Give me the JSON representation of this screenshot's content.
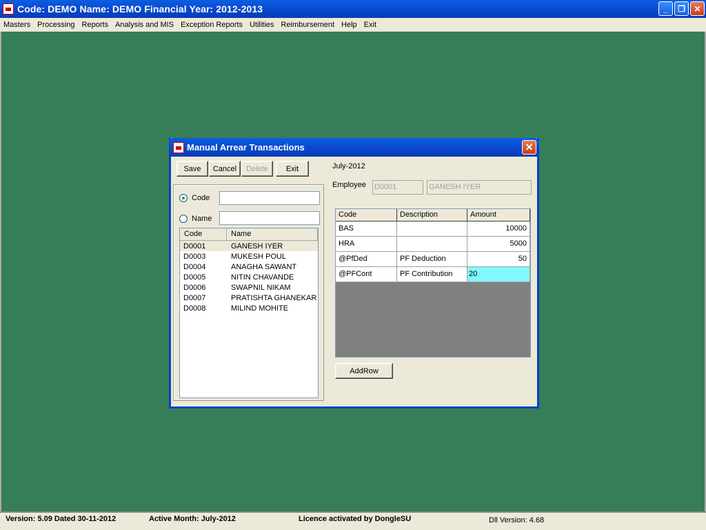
{
  "window": {
    "title": "Code: DEMO Name: DEMO Financial Year: 2012-2013",
    "btn_minimize": "_",
    "btn_restore": "❐",
    "btn_close": "✕"
  },
  "menu": [
    "Masters",
    "Processing",
    "Reports",
    "Analysis and MIS",
    "Exception Reports",
    "Utilities",
    "Reimbursement",
    "Help",
    "Exit"
  ],
  "dialog": {
    "title": "Manual Arrear Transactions",
    "close": "✕",
    "buttons": {
      "save": "Save",
      "cancel": "Cancel",
      "delete": "Delete",
      "exit": "Exit",
      "add_row": "AddRow"
    },
    "month": "July-2012",
    "search": {
      "code_label": "Code",
      "name_label": "Name",
      "selected": "Code"
    },
    "employee_label": "Employee",
    "employee_code": "D0001",
    "employee_name": "GANESH IYER",
    "list": {
      "headers": [
        "Code",
        "Name"
      ],
      "rows": [
        {
          "code": "D0001",
          "name": "GANESH IYER"
        },
        {
          "code": "D0003",
          "name": "MUKESH POUL"
        },
        {
          "code": "D0004",
          "name": "ANAGHA SAWANT"
        },
        {
          "code": "D0005",
          "name": "NITIN CHAVANDE"
        },
        {
          "code": "D0006",
          "name": "SWAPNIL NIKAM"
        },
        {
          "code": "D0007",
          "name": "PRATISHTA GHANEKAR"
        },
        {
          "code": "D0008",
          "name": "MILIND MOHITE"
        }
      ]
    },
    "grid": {
      "headers": [
        "Code",
        "Description",
        "Amount"
      ],
      "rows": [
        {
          "code": "BAS",
          "description": "",
          "amount": "10000"
        },
        {
          "code": "HRA",
          "description": "",
          "amount": "5000"
        },
        {
          "code": "@PfDed",
          "description": "PF Deduction",
          "amount": "50"
        },
        {
          "code": "@PFCont",
          "description": "PF Contribution",
          "amount": "20"
        }
      ]
    }
  },
  "status": {
    "version": "Version: 5.09 Dated 30-11-2012",
    "active_month": "Active Month: July-2012",
    "licence": "Licence activated by DongleSU",
    "dll_version": "Dll Version: 4.68"
  },
  "colors": {
    "desktop": "#367e58",
    "active_cell": "#7ff8ff",
    "titlebar": "#0b4cd6"
  }
}
